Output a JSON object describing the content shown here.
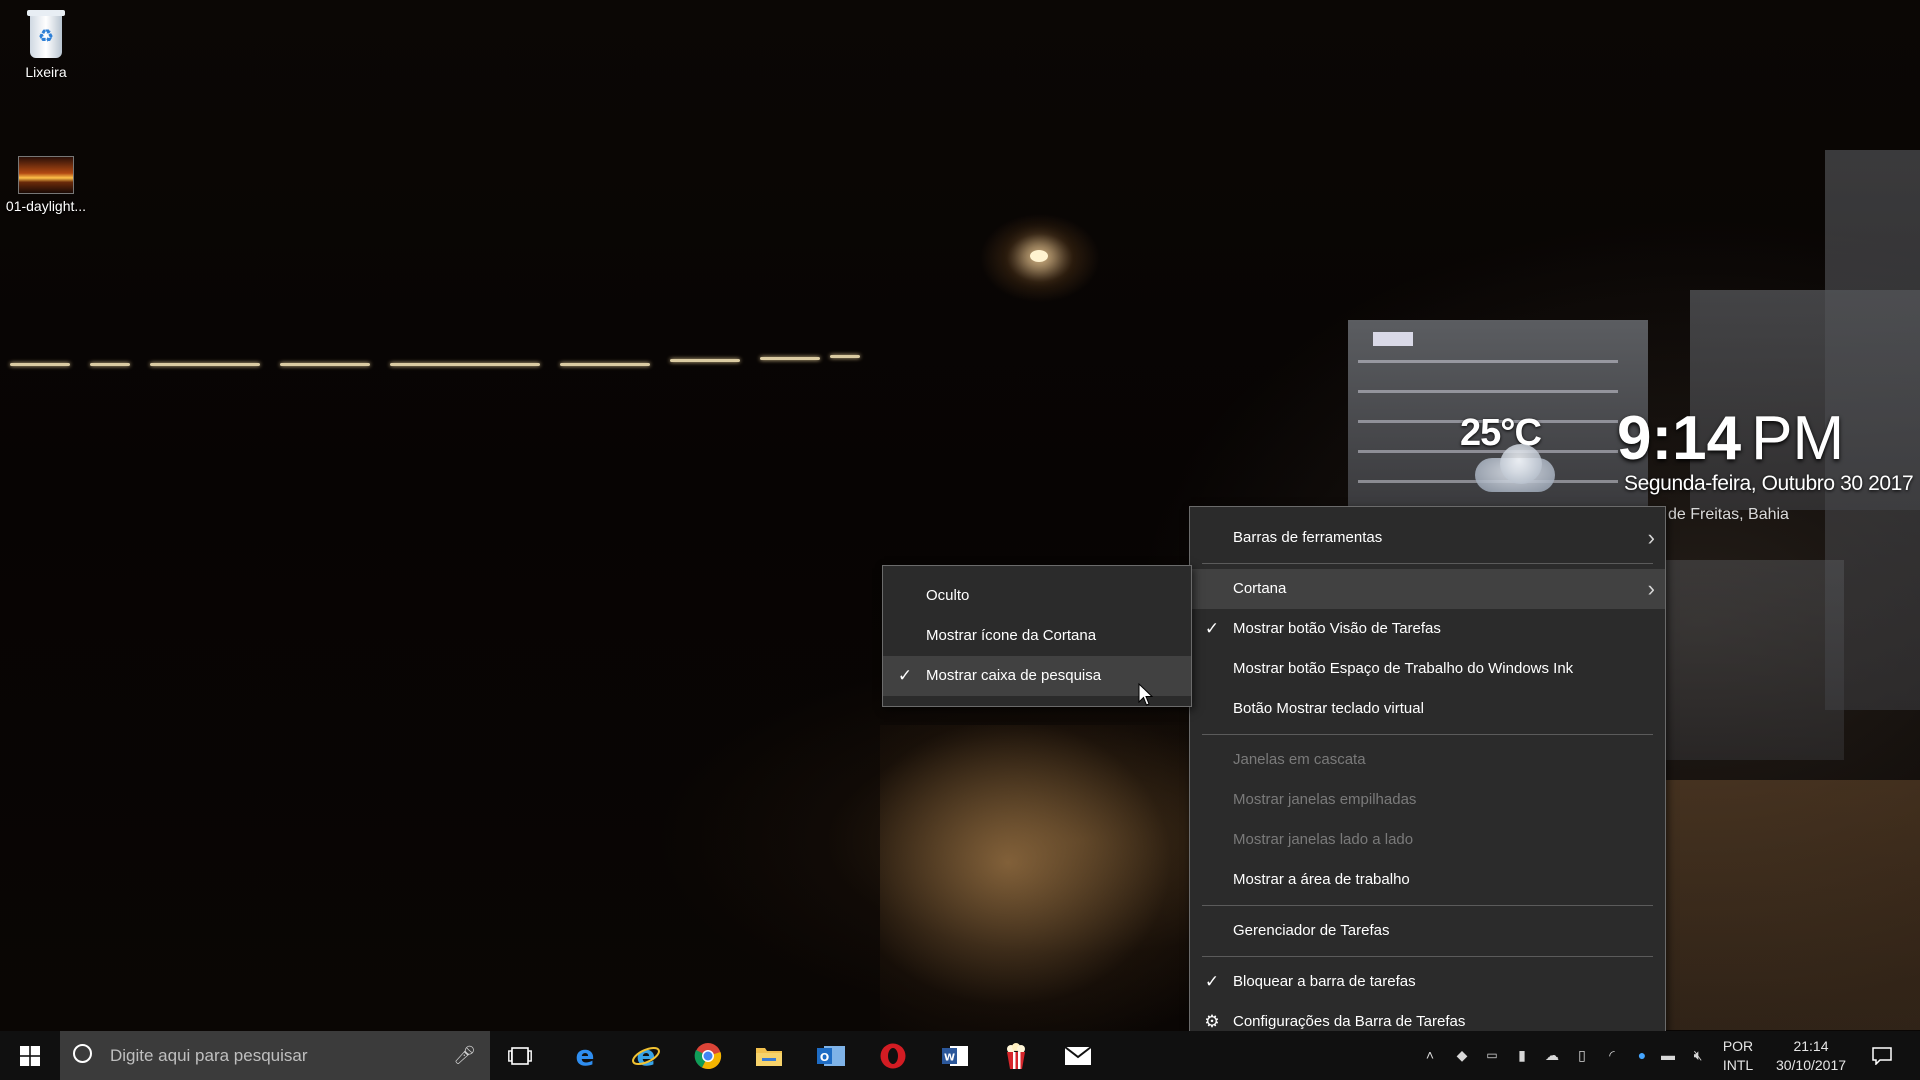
{
  "desktop": {
    "icons": [
      {
        "label": "Lixeira",
        "icon": "recycle-bin-icon"
      },
      {
        "label": "01-daylight...",
        "icon": "image-file-icon"
      }
    ]
  },
  "widget": {
    "temperature": "25°C",
    "time": "9:14",
    "ampm": "PM",
    "date": "Segunda-feira, Outubro 30 2017",
    "location": "de Freitas, Bahia",
    "weather_icon": "cloudy-night-icon"
  },
  "context_menu": {
    "items": [
      {
        "label": "Barras de ferramentas",
        "submenu": true
      },
      {
        "label": "Cortana",
        "submenu": true,
        "highlighted": true
      },
      {
        "label": "Mostrar botão Visão de Tarefas",
        "checked": true
      },
      {
        "label": "Mostrar botão Espaço de Trabalho do Windows Ink"
      },
      {
        "label": "Botão Mostrar teclado virtual"
      },
      {
        "label": "Janelas em cascata",
        "disabled": true
      },
      {
        "label": "Mostrar janelas empilhadas",
        "disabled": true
      },
      {
        "label": "Mostrar janelas lado a lado",
        "disabled": true
      },
      {
        "label": "Mostrar a área de trabalho"
      },
      {
        "label": "Gerenciador de Tarefas"
      },
      {
        "label": "Bloquear a barra de tarefas",
        "checked": true
      },
      {
        "label": "Configurações da Barra de Tarefas",
        "icon": "gear-icon"
      }
    ]
  },
  "cortana_submenu": {
    "items": [
      {
        "label": "Oculto"
      },
      {
        "label": "Mostrar ícone da Cortana"
      },
      {
        "label": "Mostrar caixa de pesquisa",
        "checked": true,
        "highlighted": true
      }
    ]
  },
  "taskbar": {
    "search_placeholder": "Digite aqui para pesquisar",
    "pinned_apps": [
      "task-view-icon",
      "edge-icon",
      "internet-explorer-icon",
      "chrome-icon",
      "file-explorer-icon",
      "outlook-icon",
      "opera-icon",
      "word-icon",
      "popcorn-icon",
      "mail-icon"
    ],
    "language": "POR",
    "keyboard": "INTL",
    "time": "21:14",
    "date": "30/10/2017"
  }
}
